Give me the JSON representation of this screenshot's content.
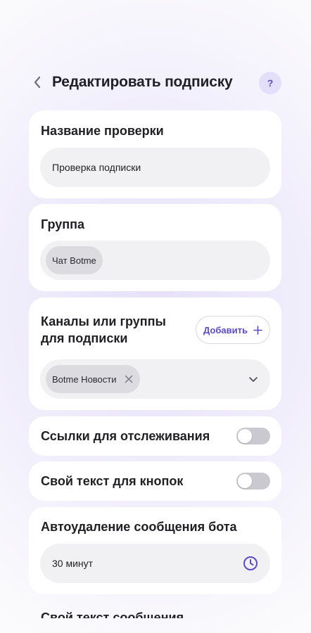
{
  "header": {
    "title": "Редактировать подписку",
    "help_label": "?"
  },
  "check_name": {
    "title": "Название проверки",
    "value": "Проверка подписки"
  },
  "group": {
    "title": "Группа",
    "chip": "Чат Botme"
  },
  "channels": {
    "title_line1": "Каналы или группы",
    "title_line2": "для подписки",
    "add_label": "Добавить",
    "chip": "Botme Новости"
  },
  "tracking_links": {
    "title": "Ссылки для отслеживания",
    "enabled": false
  },
  "button_text": {
    "title": "Свой текст для кнопок",
    "enabled": false
  },
  "autodelete": {
    "title": "Автоудаление сообщения бота",
    "value": "30 минут"
  },
  "next_section_title": "Свой текст сообщения",
  "colors": {
    "accent": "#5b4bc4",
    "accent_soft": "#e3defa",
    "toggle_off": "#c9c9cf",
    "field_bg": "#f1f1f3",
    "chip_bg": "#dcdce0"
  }
}
